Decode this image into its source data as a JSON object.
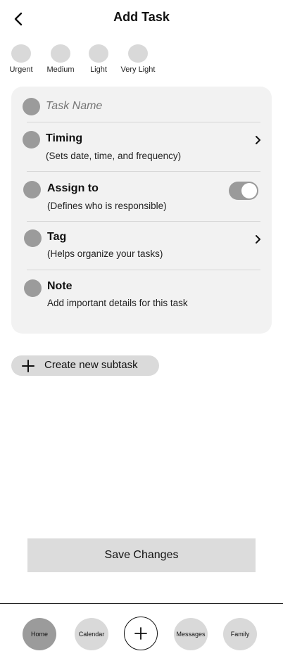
{
  "header": {
    "title": "Add Task"
  },
  "priorities": [
    {
      "label": "Urgent"
    },
    {
      "label": "Medium"
    },
    {
      "label": "Light"
    },
    {
      "label": "Very Light"
    }
  ],
  "task": {
    "name_placeholder": "Task Name"
  },
  "rows": {
    "timing": {
      "title": "Timing",
      "sub": "(Sets date, time, and frequency)"
    },
    "assign": {
      "title": "Assign to",
      "sub": "(Defines who is responsible)",
      "toggle_on": true
    },
    "tag": {
      "title": "Tag",
      "sub": "(Helps organize your tasks)"
    },
    "note": {
      "title": "Note",
      "sub": "Add important details for this task"
    }
  },
  "subtask": {
    "label": "Create new subtask"
  },
  "save": {
    "label": "Save Changes"
  },
  "nav": {
    "home": "Home",
    "calendar": "Calendar",
    "messages": "Messages",
    "family": "Family"
  },
  "icons": [
    "back-arrow-icon",
    "chevron-right-icon",
    "plus-icon",
    "toggle-switch"
  ],
  "colors": {
    "card_bg": "#f2f2f2",
    "placeholder_circle": "#9b9b9b",
    "priority_circle": "#d9d9d9",
    "active_nav": "#9b9b9b"
  }
}
